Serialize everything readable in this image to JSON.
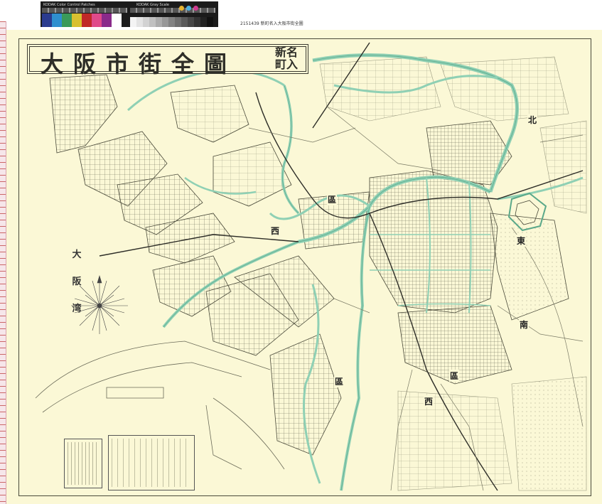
{
  "target": {
    "color_label": "KODAK Color Control Patches",
    "gray_label": "KODAK Gray Scale",
    "colors": [
      "#2a3b8f",
      "#2f8fcf",
      "#3a9a5a",
      "#d8c030",
      "#c02828",
      "#e04a8a",
      "#8a2a8a",
      "#ffffff"
    ],
    "gray_steps": [
      "#f4f4f4",
      "#e4e4e4",
      "#d2d2d2",
      "#c0c0c0",
      "#ababab",
      "#979797",
      "#828282",
      "#6e6e6e",
      "#5a5a5a",
      "#474747",
      "#343434",
      "#222222",
      "#111111"
    ],
    "dots": [
      "#e8b430",
      "#4ab0e0",
      "#d03a90"
    ]
  },
  "accession": "2151439  新町名入大阪市街全圖",
  "map": {
    "title": "大阪市街全圖",
    "subtitle": "新名町入",
    "bay_label": "大阪湾",
    "district_labels": [
      "北",
      "東",
      "南",
      "西",
      "西",
      "區",
      "區",
      "區"
    ],
    "colors": {
      "paper": "#fbf8d6",
      "ink": "#3a3a30",
      "river": "#8fd0b4",
      "river_edge": "#5aa889"
    }
  }
}
